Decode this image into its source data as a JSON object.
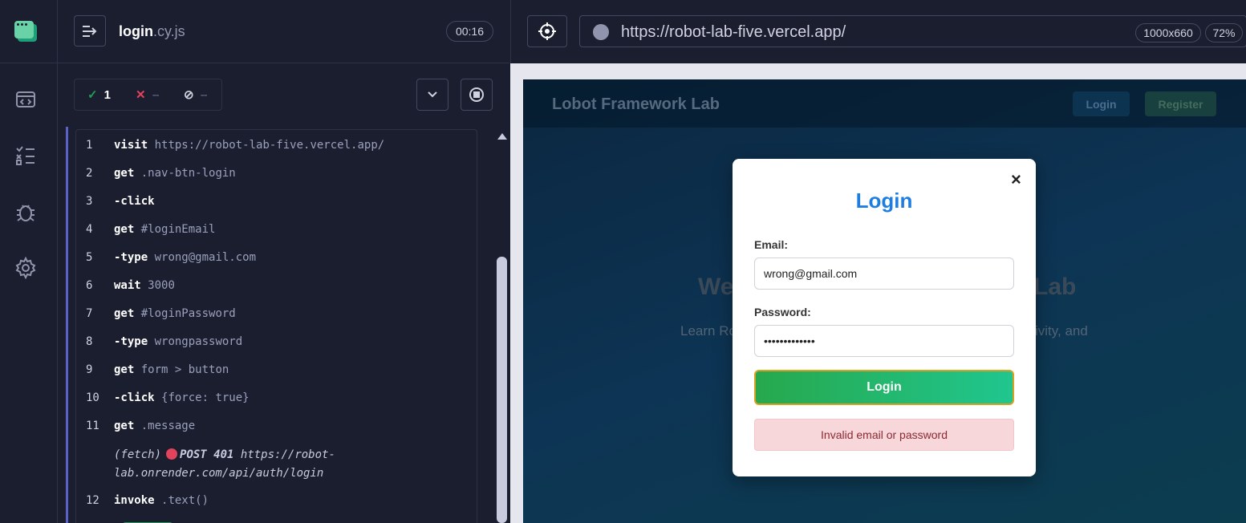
{
  "spec": {
    "name": "login",
    "ext": ".cy.js",
    "timer": "00:16"
  },
  "stats": {
    "passed": "1",
    "failed": "--",
    "pending": "--"
  },
  "commands": [
    {
      "num": "1",
      "name": "visit",
      "msg": "https://robot-lab-five.vercel.app/"
    },
    {
      "num": "2",
      "name": "get",
      "msg": ".nav-btn-login"
    },
    {
      "num": "3",
      "name": "-click",
      "msg": ""
    },
    {
      "num": "4",
      "name": "get",
      "msg": "#loginEmail"
    },
    {
      "num": "5",
      "name": "-type",
      "msg": "wrong@gmail.com"
    },
    {
      "num": "6",
      "name": "wait",
      "msg": "3000"
    },
    {
      "num": "7",
      "name": "get",
      "msg": "#loginPassword"
    },
    {
      "num": "8",
      "name": "-type",
      "msg": "wrongpassword"
    },
    {
      "num": "9",
      "name": "get",
      "msg": "form > button"
    },
    {
      "num": "10",
      "name": "-click",
      "msg": "{force: true}"
    },
    {
      "num": "11",
      "name": "get",
      "msg": ".message"
    },
    {
      "num": "12",
      "name": "invoke",
      "msg": ".text()"
    }
  ],
  "fetch": {
    "label": "(fetch)",
    "method": "POST 401",
    "url_line1": "https://robot-",
    "url_line2": "lab.onrender.com/api/auth/login"
  },
  "aut": {
    "url": "https://robot-lab-five.vercel.app/",
    "viewport": "1000x660",
    "zoom": "72%"
  },
  "app": {
    "brand": "Lobot Framework Lab",
    "nav_login": "Login",
    "nav_register": "Register",
    "hero_title_left": "We",
    "hero_title_right": "Lab",
    "hero_sub_left": "Learn Ro",
    "hero_sub_right": "ivity, and"
  },
  "modal": {
    "close": "×",
    "title": "Login",
    "email_label": "Email:",
    "email_value": "wrong@gmail.com",
    "password_label": "Password:",
    "password_value": "•••••••••••••",
    "submit_label": "Login",
    "error": "Invalid email or password"
  },
  "colors": {
    "passed": "#1f9e58",
    "failed": "#e0435b",
    "accent": "#1d7de0",
    "login_gradient_start": "#27a84d",
    "login_gradient_end": "#20c68f"
  },
  "icons": [
    "cypress-logo-icon",
    "spec-list-icon",
    "runs-icon",
    "debug-icon",
    "settings-icon",
    "selector-playground-icon",
    "chevron-down-icon",
    "stop-icon"
  ]
}
